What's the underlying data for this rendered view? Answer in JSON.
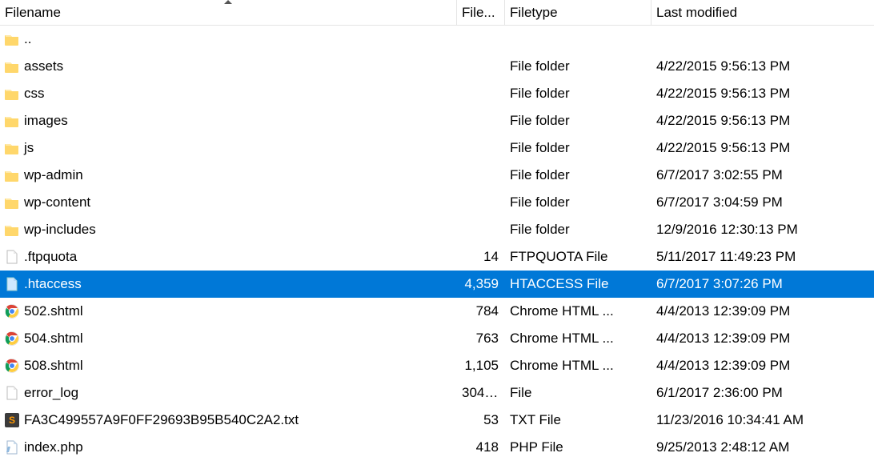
{
  "columns": {
    "filename": "Filename",
    "filesize": "File...",
    "filetype": "Filetype",
    "modified": "Last modified"
  },
  "rows": [
    {
      "icon": "folder",
      "name": "..",
      "size": "",
      "type": "",
      "modified": "",
      "selected": false
    },
    {
      "icon": "folder",
      "name": "assets",
      "size": "",
      "type": "File folder",
      "modified": "4/22/2015 9:56:13 PM",
      "selected": false
    },
    {
      "icon": "folder",
      "name": "css",
      "size": "",
      "type": "File folder",
      "modified": "4/22/2015 9:56:13 PM",
      "selected": false
    },
    {
      "icon": "folder",
      "name": "images",
      "size": "",
      "type": "File folder",
      "modified": "4/22/2015 9:56:13 PM",
      "selected": false
    },
    {
      "icon": "folder",
      "name": "js",
      "size": "",
      "type": "File folder",
      "modified": "4/22/2015 9:56:13 PM",
      "selected": false
    },
    {
      "icon": "folder",
      "name": "wp-admin",
      "size": "",
      "type": "File folder",
      "modified": "6/7/2017 3:02:55 PM",
      "selected": false
    },
    {
      "icon": "folder",
      "name": "wp-content",
      "size": "",
      "type": "File folder",
      "modified": "6/7/2017 3:04:59 PM",
      "selected": false
    },
    {
      "icon": "folder",
      "name": "wp-includes",
      "size": "",
      "type": "File folder",
      "modified": "12/9/2016 12:30:13 PM",
      "selected": false
    },
    {
      "icon": "file",
      "name": ".ftpquota",
      "size": "14",
      "type": "FTPQUOTA File",
      "modified": "5/11/2017 11:49:23 PM",
      "selected": false
    },
    {
      "icon": "file-sel",
      "name": ".htaccess",
      "size": "4,359",
      "type": "HTACCESS File",
      "modified": "6/7/2017 3:07:26 PM",
      "selected": true
    },
    {
      "icon": "chrome",
      "name": "502.shtml",
      "size": "784",
      "type": "Chrome HTML ...",
      "modified": "4/4/2013 12:39:09 PM",
      "selected": false
    },
    {
      "icon": "chrome",
      "name": "504.shtml",
      "size": "763",
      "type": "Chrome HTML ...",
      "modified": "4/4/2013 12:39:09 PM",
      "selected": false
    },
    {
      "icon": "chrome",
      "name": "508.shtml",
      "size": "1,105",
      "type": "Chrome HTML ...",
      "modified": "4/4/2013 12:39:09 PM",
      "selected": false
    },
    {
      "icon": "file",
      "name": "error_log",
      "size": "304,...",
      "type": "File",
      "modified": "6/1/2017 2:36:00 PM",
      "selected": false
    },
    {
      "icon": "sublime",
      "name": "FA3C499557A9F0FF29693B95B540C2A2.txt",
      "size": "53",
      "type": "TXT File",
      "modified": "11/23/2016 10:34:41 AM",
      "selected": false
    },
    {
      "icon": "php",
      "name": "index.php",
      "size": "418",
      "type": "PHP File",
      "modified": "9/25/2013 2:48:12 AM",
      "selected": false
    }
  ]
}
